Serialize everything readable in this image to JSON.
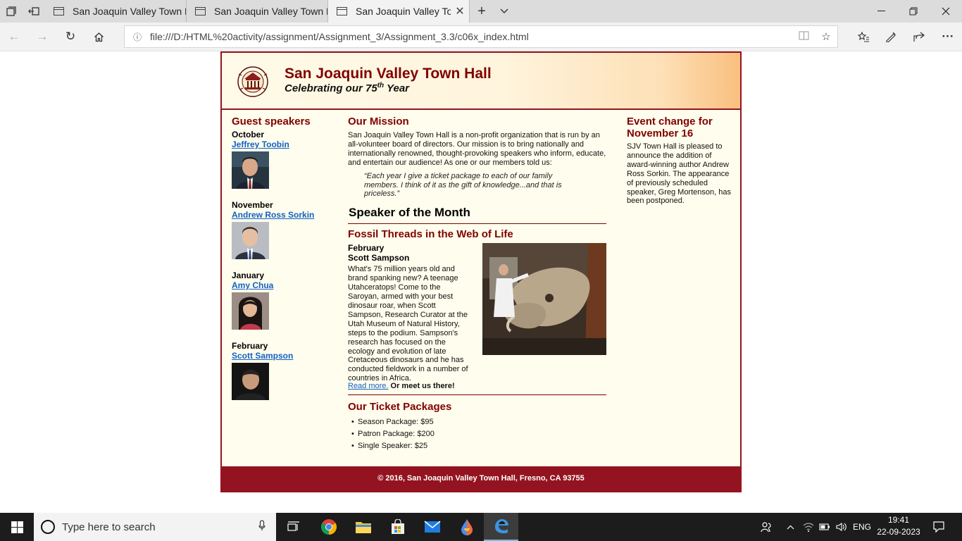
{
  "browser": {
    "tabs": [
      {
        "title": "San Joaquin Valley Town Ha",
        "active": false
      },
      {
        "title": "San Joaquin Valley Town Ha",
        "active": false
      },
      {
        "title": "San Joaquin Valley Town",
        "active": true
      }
    ],
    "url": "file:///D:/HTML%20activity/assignment/Assignment_3/Assignment_3.3/c06x_index.html"
  },
  "site": {
    "title": "San Joaquin Valley Town Hall",
    "tagline_prefix": "Celebrating our ",
    "tagline_number": "75",
    "tagline_sup": "th",
    "tagline_suffix": " Year",
    "footer": "© 2016, San Joaquin Valley Town Hall, Fresno, CA 93755"
  },
  "sidebar": {
    "heading": "Guest speakers",
    "speakers": [
      {
        "month": "October",
        "name": "Jeffrey Toobin"
      },
      {
        "month": "November",
        "name": "Andrew Ross Sorkin"
      },
      {
        "month": "January",
        "name": "Amy Chua"
      },
      {
        "month": "February",
        "name": "Scott Sampson"
      }
    ]
  },
  "main": {
    "mission_heading": "Our Mission",
    "mission_text": "San Joaquin Valley Town Hall is a non-profit organization that is run by an all-volunteer board of directors. Our mission is to bring nationally and internationally renowned, thought-provoking speakers who inform, educate, and entertain our audience! As one or our members told us:",
    "quote": "“Each year I give a ticket package to each of our family members. I think of it as the gift of knowledge...and that is priceless.”",
    "som_heading": "Speaker of the Month",
    "feature_title": "Fossil Threads in the Web of Life",
    "feature_month": "February",
    "feature_speaker": "Scott Sampson",
    "feature_text": "What's 75 million years old and brand spanking new? A teenage Utahceratops! Come to the Saroyan, armed with your best dinosaur roar, when Scott Sampson, Research Curator at the Utah Museum of Natural History, steps to the podium. Sampson's research has focused on the ecology and evolution of late Cretaceous dinosaurs and he has conducted fieldwork in a number of countries in Africa.",
    "read_more": "Read more.",
    "meet_us": " Or meet us there!",
    "tickets_heading": "Our Ticket Packages",
    "tickets": [
      "Season Package: $95",
      "Patron Package: $200",
      "Single Speaker: $25"
    ]
  },
  "aside": {
    "heading": "Event change for November 16",
    "text": "SJV Town Hall is pleased to announce the addition of award-winning author Andrew Ross Sorkin. The appearance of previously scheduled speaker, Greg Mortenson, has been postponed."
  },
  "taskbar": {
    "search_placeholder": "Type here to search",
    "language": "ENG",
    "time": "19:41",
    "date": "22-09-2023"
  }
}
